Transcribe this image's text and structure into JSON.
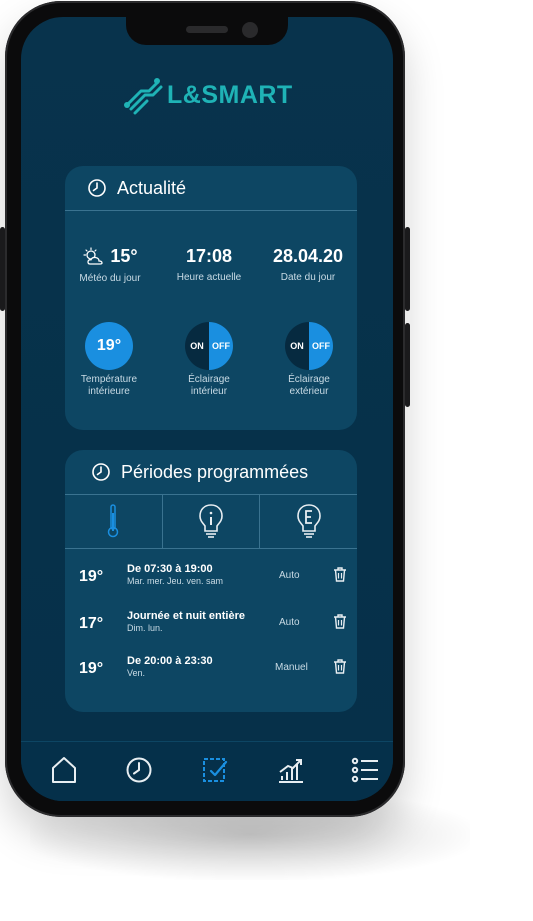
{
  "brand": {
    "name": "L&SMART",
    "color": "#1fb3b6"
  },
  "actualite": {
    "title": "Actualité",
    "weather": {
      "value": "15°",
      "label": "Météo du jour",
      "icon": "partly-cloudy-icon"
    },
    "time": {
      "value": "17:08",
      "label": "Heure actuelle"
    },
    "date": {
      "value": "28.04.20",
      "label": "Date du jour"
    },
    "indoor_temp": {
      "value": "19°",
      "label_line1": "Température",
      "label_line2": "intérieure"
    },
    "indoor_light": {
      "on": "ON",
      "off": "OFF",
      "label_line1": "Éclairage",
      "label_line2": "intérieur",
      "active": "OFF"
    },
    "outdoor_light": {
      "on": "ON",
      "off": "OFF",
      "label_line1": "Éclairage",
      "label_line2": "extérieur",
      "active": "OFF"
    }
  },
  "periodes": {
    "title": "Périodes programmées",
    "tabs": [
      {
        "icon": "thermometer-icon",
        "active": true
      },
      {
        "icon": "bulb-interior-icon",
        "active": false
      },
      {
        "icon": "bulb-exterior-icon",
        "active": false
      }
    ],
    "items": [
      {
        "temp": "19°",
        "title": "De 07:30 à 19:00",
        "days": "Mar. mer. Jeu. ven. sam",
        "mode": "Auto"
      },
      {
        "temp": "17°",
        "title": "Journée et nuit entière",
        "days": "Dim. lun.",
        "mode": "Auto"
      },
      {
        "temp": "19°",
        "title": "De 20:00 à 23:30",
        "days": "Ven.",
        "mode": "Manuel"
      }
    ]
  },
  "nav": [
    {
      "icon": "home-icon",
      "active": false
    },
    {
      "icon": "clock-icon",
      "active": false
    },
    {
      "icon": "schedule-check-icon",
      "active": true
    },
    {
      "icon": "chart-icon",
      "active": false
    },
    {
      "icon": "menu-list-icon",
      "active": false
    }
  ],
  "colors": {
    "accent": "#1a8fe0",
    "card": "#0d4663",
    "background": "#06314a",
    "icon": "#e8eef2"
  }
}
